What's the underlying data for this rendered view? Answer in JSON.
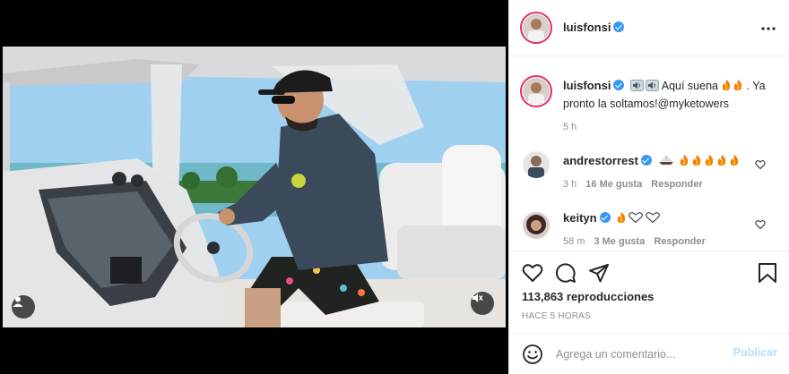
{
  "post": {
    "author": "luisfonsi",
    "caption_author": "luisfonsi",
    "caption_text": "Aquí suena",
    "caption_line2": "pronto la soltamos!@myketowers",
    "caption_after_fire": ". Ya",
    "caption_time": "5 h",
    "views": "113,863 reproducciones",
    "posted_ago": "HACE 5 HORAS"
  },
  "comments": [
    {
      "user": "andrestorrest",
      "time": "3 h",
      "likes": "16 Me gusta",
      "reply": "Responder"
    },
    {
      "user": "keityn",
      "time": "58 m",
      "likes": "3 Me gusta",
      "reply": "Responder"
    }
  ],
  "add_comment": {
    "placeholder": "Agrega un comentario...",
    "publish_label": "Publicar"
  },
  "colors": {
    "verified": "#3897f0",
    "publish_disabled": "#b2dffc",
    "story_ring": "#e1306c",
    "muted": "#8e8e8e"
  },
  "icons": [
    "user-tag-icon",
    "muted-speaker-icon",
    "more-options-icon",
    "heart-icon",
    "comment-icon",
    "share-icon",
    "bookmark-icon",
    "emoji-icon",
    "speaker-icon",
    "fire-icon",
    "sailboat-icon",
    "white-heart-icon"
  ]
}
